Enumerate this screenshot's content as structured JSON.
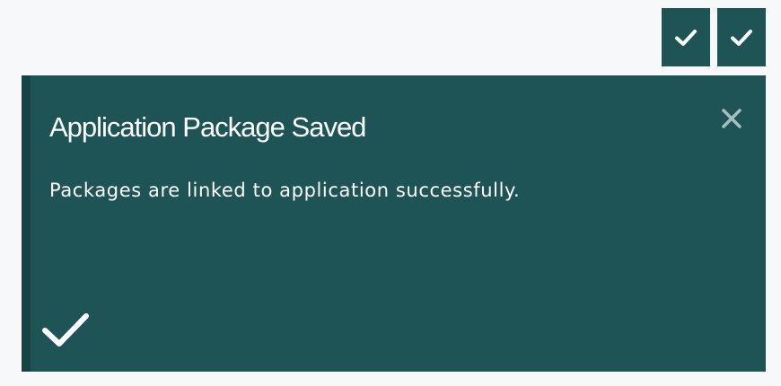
{
  "colors": {
    "page_background": "#f7f8fa",
    "notification_background": "#1f5457",
    "notification_accent": "#174344",
    "text": "#ffffff",
    "close_icon": "#a8bfc0"
  },
  "minimized_notifications": [
    {
      "icon": "checkmark-icon",
      "status": "success"
    },
    {
      "icon": "checkmark-icon",
      "status": "success"
    }
  ],
  "notification": {
    "title": "Application Package Saved",
    "message": "Packages are linked to application successfully.",
    "close_icon": "close-icon",
    "status_icon": "checkmark-icon"
  }
}
